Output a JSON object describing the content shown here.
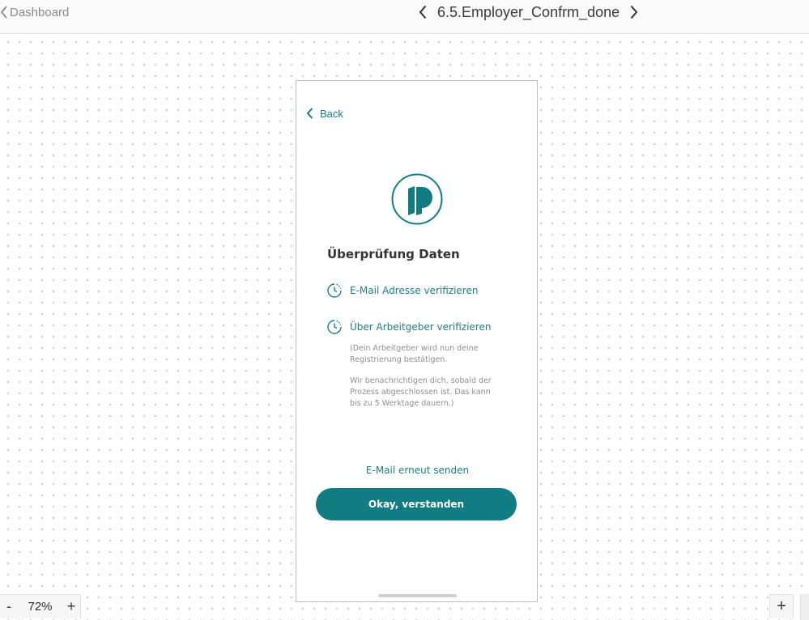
{
  "topbar": {
    "back_label": "Dashboard",
    "screen_title": "6.5.Employer_Confrm_done"
  },
  "phone": {
    "back_label": "Back",
    "heading": "Überprüfung Daten",
    "steps": [
      {
        "label": "E-Mail Adresse verifizieren",
        "icon": "clock-pending-icon"
      },
      {
        "label": "Über Arbeitgeber verifizieren",
        "icon": "clock-pending-icon"
      }
    ],
    "note_1": "(Dein Arbeitgeber wird nun deine Registrierung bestätigen.",
    "note_2": "Wir benachrichtigen dich, sobald der Prozess abgeschlossen ist. Das kann bis zu 5 Werktage dauern.)",
    "resend_label": "E-Mail erneut senden",
    "primary_label": "Okay, verstanden"
  },
  "zoom": {
    "minus": "-",
    "value": "72%",
    "plus": "+"
  },
  "bottom_right": {
    "plus": "+"
  },
  "colors": {
    "accent": "#117d83",
    "accent_text": "#1b7f86",
    "heading": "#333333",
    "muted": "#8e8e8e"
  }
}
